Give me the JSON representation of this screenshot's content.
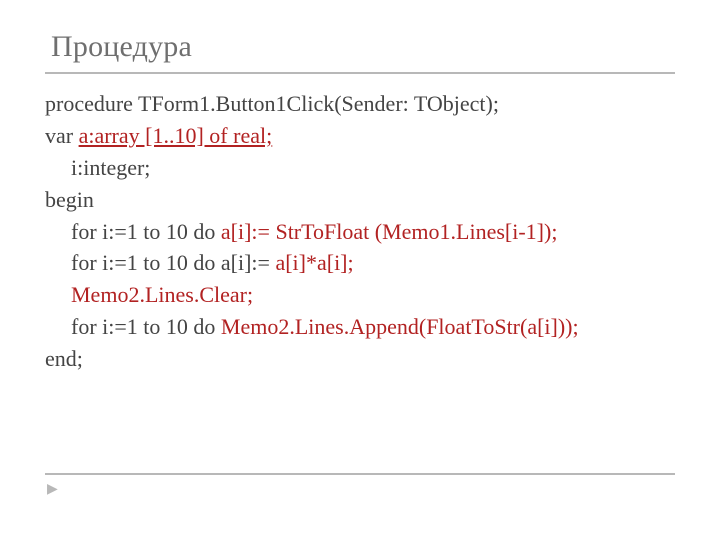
{
  "slide": {
    "title": "Процедура",
    "line1": {
      "text": "procedure TForm1.Button1Click(Sender: TObject);"
    },
    "line2": {
      "pre": "var ",
      "red": "a:array [1..10] of real;"
    },
    "line3": {
      "text": "i:integer;"
    },
    "line4": {
      "text": "begin"
    },
    "line5": {
      "pre": "for i:=1 to 10 do  ",
      "red": "a[i]:= StrToFloat (Memo1.Lines[i-1]);"
    },
    "line6": {
      "pre": "for i:=1 to 10 do a[i]:= ",
      "red": "a[i]*a[i];"
    },
    "line7": {
      "red": "Memo2.Lines.Clear;"
    },
    "line8": {
      "pre": "for i:=1 to 10 do ",
      "red": "Memo2.Lines.Append(FloatToStr(a[i]));"
    },
    "line9": {
      "text": "end;"
    },
    "bullet": "▶"
  }
}
